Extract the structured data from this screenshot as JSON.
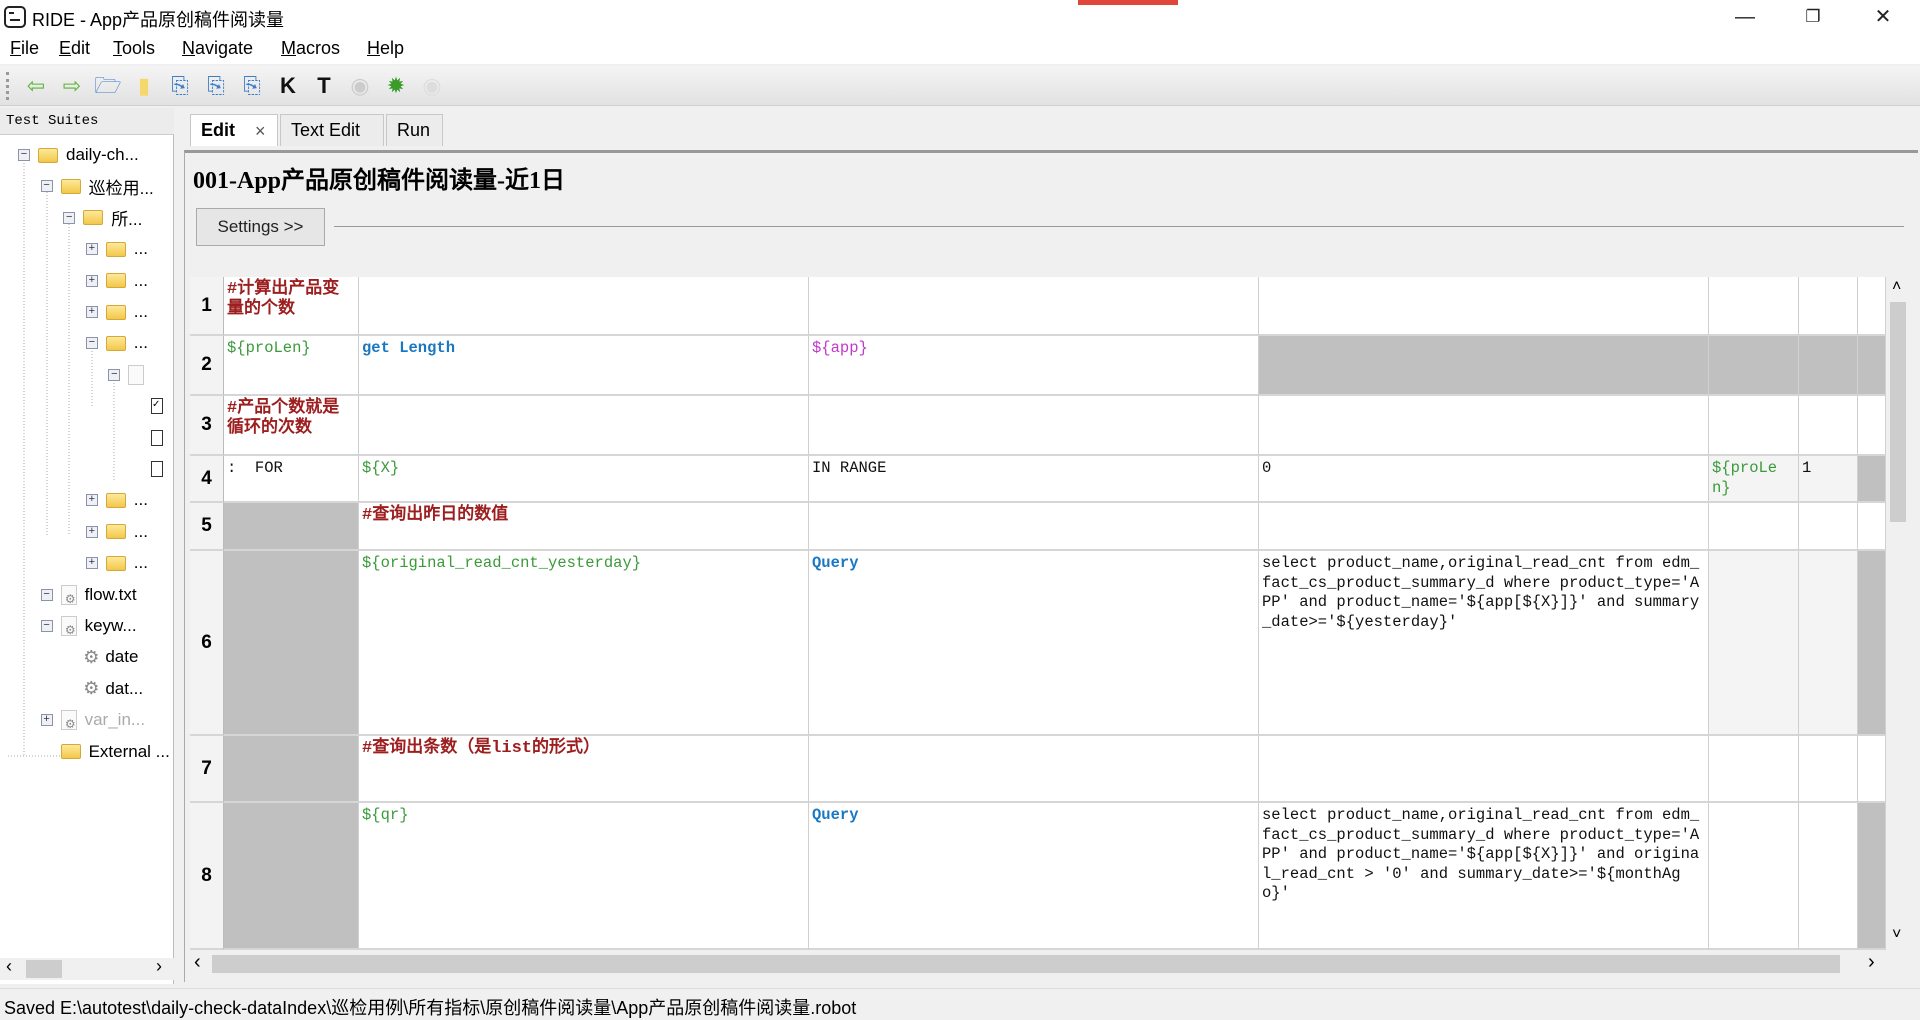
{
  "window": {
    "title": "RIDE - App产品原创稿件阅读量",
    "minimize": "—",
    "restore": "❐",
    "close": "✕",
    "accent_bar": "#e0463a"
  },
  "menu": [
    {
      "key": "F",
      "rest": "ile"
    },
    {
      "key": "E",
      "rest": "dit"
    },
    {
      "key": "T",
      "rest": "ools"
    },
    {
      "key": "N",
      "rest": "avigate"
    },
    {
      "key": "M",
      "rest": "acros"
    },
    {
      "key": "H",
      "rest": "elp"
    }
  ],
  "toolbar": [
    {
      "icon": "back-arrow-icon",
      "glyph": "⇦",
      "color": "#5bb536"
    },
    {
      "icon": "forward-arrow-icon",
      "glyph": "⇨",
      "color": "#5bb536"
    },
    {
      "icon": "open-folder-icon",
      "glyph": "🗁",
      "color": "#3d7cc9"
    },
    {
      "icon": "new-file-icon",
      "glyph": "▮",
      "color": "#f6d76b"
    },
    {
      "icon": "save-icon",
      "glyph": "⎘",
      "color": "#3d7cc9"
    },
    {
      "icon": "save-all-icon",
      "glyph": "⎘",
      "color": "#3d7cc9"
    },
    {
      "icon": "save-as-icon",
      "glyph": "⎘",
      "color": "#3d7cc9"
    },
    {
      "icon": "search-keywords-icon",
      "glyph": "K",
      "color": "#111"
    },
    {
      "icon": "search-tests-icon",
      "glyph": "T",
      "color": "#111"
    },
    {
      "icon": "run-icon",
      "glyph": "◉",
      "color": "#ccc"
    },
    {
      "icon": "debug-bug-icon",
      "glyph": "✹",
      "color": "#3a9a2a"
    },
    {
      "icon": "stop-icon",
      "glyph": "◉",
      "color": "#ddd"
    }
  ],
  "tree": {
    "header": "Test Suites",
    "nodes": [
      {
        "level": 0,
        "toggle": "−",
        "icon": "folder",
        "label": "daily-ch..."
      },
      {
        "level": 1,
        "toggle": "−",
        "icon": "folder",
        "label": "巡检用..."
      },
      {
        "level": 2,
        "toggle": "−",
        "icon": "folder",
        "label": "所..."
      },
      {
        "level": 3,
        "toggle": "+",
        "icon": "folder",
        "label": "..."
      },
      {
        "level": 3,
        "toggle": "+",
        "icon": "folder",
        "label": "..."
      },
      {
        "level": 3,
        "toggle": "+",
        "icon": "folder",
        "label": "..."
      },
      {
        "level": 3,
        "toggle": "−",
        "icon": "folder",
        "label": "..."
      },
      {
        "level": 4,
        "toggle": "−",
        "icon": "file",
        "label": ""
      },
      {
        "level": 5,
        "toggle": "",
        "icon": "checkbox-checked",
        "label": ""
      },
      {
        "level": 5,
        "toggle": "",
        "icon": "checkbox",
        "label": ""
      },
      {
        "level": 5,
        "toggle": "",
        "icon": "checkbox",
        "label": ""
      },
      {
        "level": 3,
        "toggle": "+",
        "icon": "folder",
        "label": "..."
      },
      {
        "level": 3,
        "toggle": "+",
        "icon": "folder",
        "label": "..."
      },
      {
        "level": 3,
        "toggle": "+",
        "icon": "folder",
        "label": "..."
      },
      {
        "level": 1,
        "toggle": "−",
        "icon": "resource",
        "label": "flow.txt"
      },
      {
        "level": 1,
        "toggle": "−",
        "icon": "resource",
        "label": "keyw..."
      },
      {
        "level": 2,
        "toggle": "",
        "icon": "gear",
        "label": "date"
      },
      {
        "level": 2,
        "toggle": "",
        "icon": "gear",
        "label": "dat..."
      },
      {
        "level": 1,
        "toggle": "+",
        "icon": "resource",
        "label": "var_in...",
        "disabled": true
      },
      {
        "level": 1,
        "toggle": "",
        "icon": "external",
        "label": "External ..."
      }
    ]
  },
  "tabs": [
    {
      "label": "Edit",
      "active": true,
      "close": "×"
    },
    {
      "label": "Text Edit"
    },
    {
      "label": "Run"
    }
  ],
  "editor": {
    "title": "001-App产品原创稿件阅读量-近1日",
    "settings_label": "Settings >>",
    "rows": [
      {
        "num": "1",
        "cells": [
          {
            "t": "#计算出产品变量的个数",
            "c": "comment"
          },
          {},
          {},
          {},
          {},
          {},
          {}
        ]
      },
      {
        "num": "2",
        "cells": [
          {
            "t": "${proLen}",
            "c": "var"
          },
          {
            "t": "get Length",
            "c": "kw"
          },
          {
            "t": "${app}",
            "c": "arg"
          },
          {
            "c": "gray"
          },
          {
            "c": "gray"
          },
          {
            "c": "gray"
          },
          {
            "c": "gray"
          }
        ]
      },
      {
        "num": "3",
        "cells": [
          {
            "t": "#产品个数就是循环的次数",
            "c": "comment"
          },
          {},
          {},
          {},
          {},
          {},
          {}
        ]
      },
      {
        "num": "4",
        "cells": [
          {
            "t": ":  FOR",
            "c": "txt"
          },
          {
            "t": "${X}",
            "c": "var"
          },
          {
            "t": "IN RANGE",
            "c": "txt"
          },
          {
            "t": "0",
            "c": "txt"
          },
          {
            "t": "${proLen}",
            "c": "var lgray"
          },
          {
            "t": "1",
            "c": "txt lgray"
          },
          {
            "c": "gray"
          }
        ]
      },
      {
        "num": "5",
        "cells": [
          {
            "c": "gray"
          },
          {
            "t": "#查询出昨日的数值",
            "c": "comment"
          },
          {},
          {},
          {},
          {},
          {}
        ]
      },
      {
        "num": "6",
        "cells": [
          {
            "c": "gray"
          },
          {
            "t": "${original_read_cnt_yesterday}",
            "c": "var"
          },
          {
            "t": "Query",
            "c": "kw"
          },
          {
            "t": "select product_name,original_read_cnt from edm_fact_cs_product_summary_d where product_type='APP' and product_name='${app[${X}]}' and summary_date>='${yesterday}'",
            "c": "txt"
          },
          {
            "c": "lgray"
          },
          {
            "c": "lgray"
          },
          {
            "c": "gray"
          }
        ]
      },
      {
        "num": "7",
        "cells": [
          {
            "c": "gray"
          },
          {
            "t": "#查询出条数（是list的形式）",
            "c": "comment"
          },
          {},
          {},
          {},
          {},
          {}
        ]
      },
      {
        "num": "8",
        "cells": [
          {
            "c": "gray"
          },
          {
            "t": "${qr}",
            "c": "var"
          },
          {
            "t": "Query",
            "c": "kw"
          },
          {
            "t": "select product_name,original_read_cnt from edm_fact_cs_product_summary_d where product_type='APP' and product_name='${app[${X}]}' and original_read_cnt > '0' and summary_date>='${monthAgo}'",
            "c": "txt"
          },
          {},
          {},
          {
            "c": "gray"
          }
        ]
      }
    ]
  },
  "scroll": {
    "up": "˄",
    "down": "˅",
    "left": "‹",
    "right": "›",
    "tree_left": "‹",
    "tree_right": "›"
  },
  "status": "Saved E:\\autotest\\daily-check-dataIndex\\巡检用例\\所有指标\\原创稿件阅读量\\App产品原创稿件阅读量.robot"
}
